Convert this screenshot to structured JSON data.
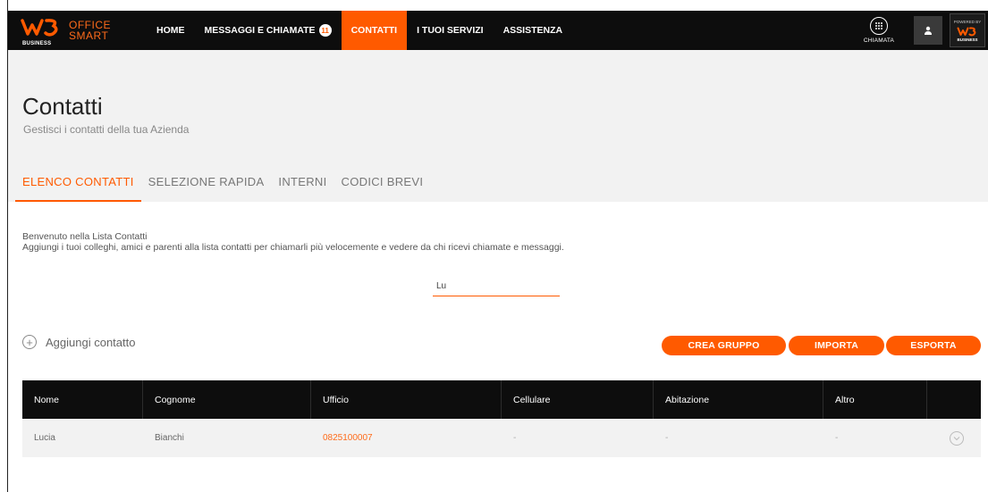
{
  "brand": {
    "business": "BUSINESS",
    "line1": "OFFICE",
    "line2": "SMART"
  },
  "nav": {
    "items": [
      {
        "label": "HOME"
      },
      {
        "label": "MESSAGGI E CHIAMATE",
        "badge": "11"
      },
      {
        "label": "CONTATTI",
        "active": true
      },
      {
        "label": "I TUOI SERVIZI"
      },
      {
        "label": "ASSISTENZA"
      }
    ],
    "call_label": "CHIAMATA",
    "powered_label": "POWERED BY",
    "powered_business": "BUSINESS"
  },
  "page": {
    "title": "Contatti",
    "subtitle": "Gestisci i contatti della tua Azienda"
  },
  "tabs": [
    {
      "label": "ELENCO CONTATTI",
      "active": true
    },
    {
      "label": "SELEZIONE RAPIDA"
    },
    {
      "label": "INTERNI"
    },
    {
      "label": "CODICI BREVI"
    }
  ],
  "intro": {
    "line1": "Benvenuto nella Lista Contatti",
    "line2": "Aggiungi i tuoi colleghi, amici e parenti alla lista contatti per chiamarli più velocemente e vedere da chi ricevi chiamate e messaggi."
  },
  "search": {
    "value": "Lu",
    "placeholder": ""
  },
  "actions": {
    "add_contact": "Aggiungi contatto",
    "crea_gruppo": "CREA GRUPPO",
    "importa": "IMPORTA",
    "esporta": "ESPORTA"
  },
  "table": {
    "columns": [
      "Nome",
      "Cognome",
      "Ufficio",
      "Cellulare",
      "Abitazione",
      "Altro"
    ],
    "rows": [
      {
        "nome": "Lucia",
        "cognome": "Bianchi",
        "ufficio": "0825100007",
        "cellulare": "-",
        "abitazione": "-",
        "altro": "-"
      }
    ]
  },
  "colors": {
    "accent": "#ff5a00",
    "navbar": "#0d0d0d",
    "header_bg": "#f2f2f2"
  }
}
